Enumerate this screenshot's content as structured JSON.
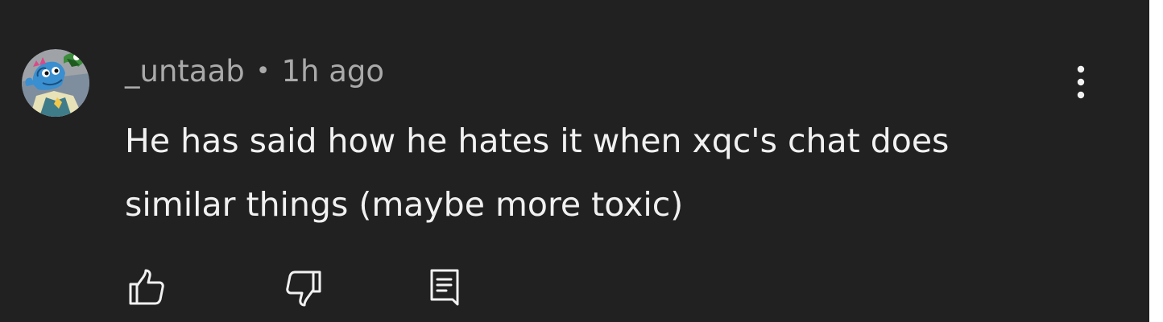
{
  "comment": {
    "author": "_untaab",
    "separator": "•",
    "timestamp": "1h ago",
    "text": "He has said how he hates it when xqc's chat does similar things (maybe more toxic)"
  },
  "icons": {
    "avatar": "dragon-avatar",
    "menu": "more-vert-icon",
    "like": "thumbs-up-icon",
    "dislike": "thumbs-down-icon",
    "reply": "reply-comment-icon"
  },
  "colors": {
    "background": "#212121",
    "text_primary": "#f1f1f1",
    "text_secondary": "#aaaaaa",
    "icon": "#f1f1f1"
  }
}
